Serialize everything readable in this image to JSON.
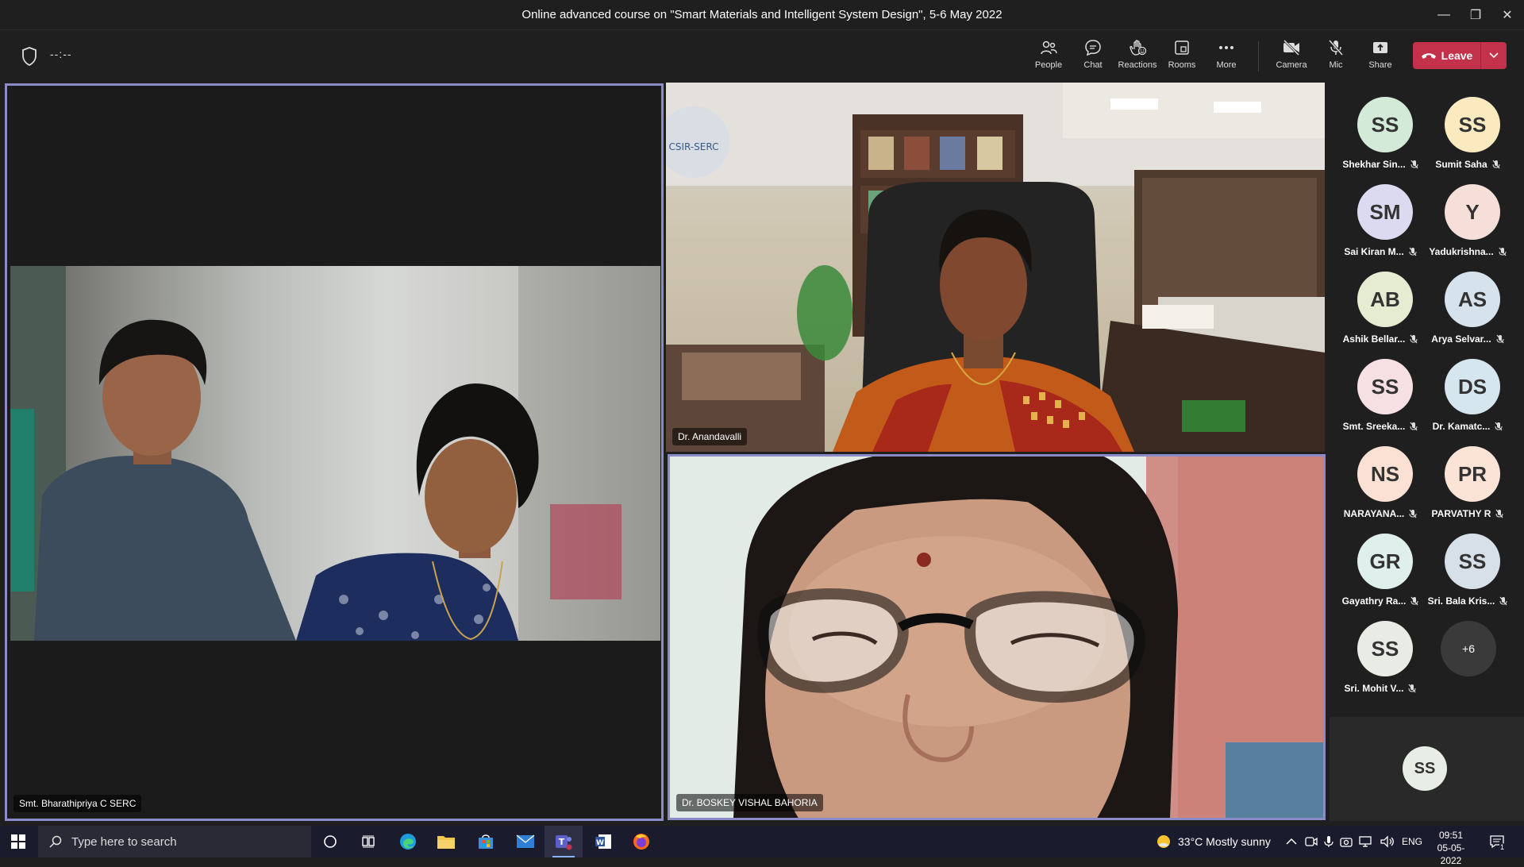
{
  "window": {
    "title": "Online advanced course on \"Smart Materials and Intelligent System Design\", 5-6 May 2022",
    "minimize": "—",
    "restore": "❐",
    "close": "✕"
  },
  "toolbar": {
    "timer": "--:--",
    "buttons": [
      {
        "label": "People",
        "icon": "people-icon"
      },
      {
        "label": "Chat",
        "icon": "chat-icon"
      },
      {
        "label": "Reactions",
        "icon": "reactions-icon"
      },
      {
        "label": "Rooms",
        "icon": "rooms-icon"
      },
      {
        "label": "More",
        "icon": "more-icon"
      },
      {
        "label": "Camera",
        "icon": "camera-off-icon"
      },
      {
        "label": "Mic",
        "icon": "mic-off-icon"
      },
      {
        "label": "Share",
        "icon": "share-icon"
      }
    ],
    "leave_label": "Leave",
    "leave_color": "#c4314b"
  },
  "stage": {
    "tiles": [
      {
        "name": "Smt. Bharathipriya C SERC"
      },
      {
        "name": "Dr. Anandavalli"
      },
      {
        "name": "Dr. BOSKEY VISHAL BAHORIA"
      }
    ],
    "active_border_color": "#8b8cc7"
  },
  "roster": {
    "participants": [
      {
        "initials": "SS",
        "name": "Shekhar Sin...",
        "color": "#d3ead9"
      },
      {
        "initials": "SS",
        "name": "Sumit Saha",
        "color": "#fbeac0"
      },
      {
        "initials": "SM",
        "name": "Sai Kiran M...",
        "color": "#dcdaf0"
      },
      {
        "initials": "Y",
        "name": "Yadukrishna...",
        "color": "#f6dfd9"
      },
      {
        "initials": "AB",
        "name": "Ashik Bellar...",
        "color": "#e6ecd2"
      },
      {
        "initials": "AS",
        "name": "Arya Selvar...",
        "color": "#d7e3ec"
      },
      {
        "initials": "SS",
        "name": "Smt. Sreeka...",
        "color": "#f7e0e3"
      },
      {
        "initials": "DS",
        "name": "Dr. Kamatc...",
        "color": "#d5e6ee"
      },
      {
        "initials": "NS",
        "name": "NARAYANA...",
        "color": "#fbe1d4"
      },
      {
        "initials": "PR",
        "name": "PARVATHY R",
        "color": "#fbe3d6"
      },
      {
        "initials": "GR",
        "name": "Gayathry Ra...",
        "color": "#dff0ec"
      },
      {
        "initials": "SS",
        "name": "Sri. Bala Kris...",
        "color": "#d7e0e8"
      },
      {
        "initials": "SS",
        "name": "Sri. Mohit V...",
        "color": "#e8ece4"
      }
    ],
    "overflow": "+6",
    "self_initials": "SS"
  },
  "taskbar": {
    "search_placeholder": "Type here to search",
    "weather": "33°C  Mostly sunny",
    "language": "ENG",
    "time": "09:51",
    "date": "05-05-2022",
    "notification_count": "1"
  }
}
